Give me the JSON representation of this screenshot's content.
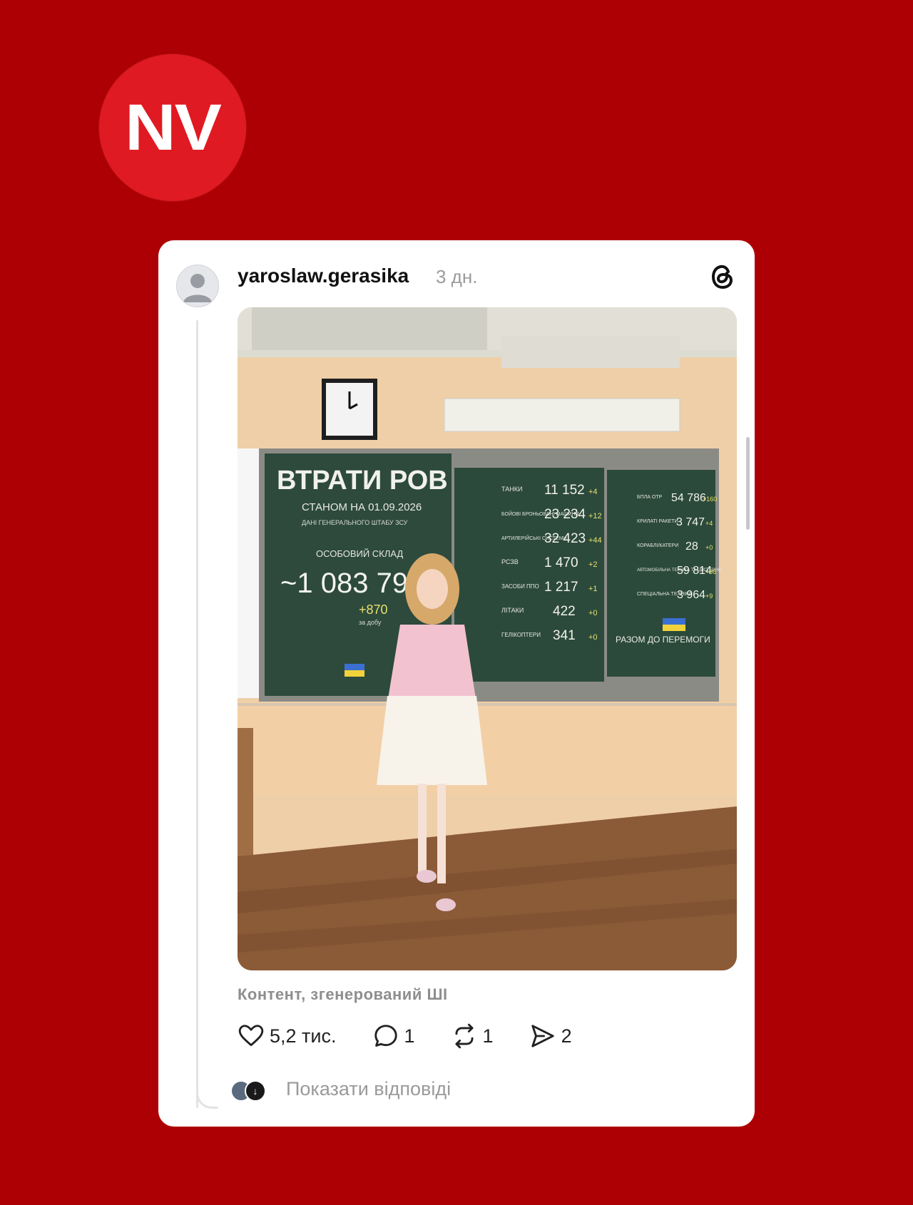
{
  "brand": {
    "logo_text": "NV"
  },
  "post": {
    "username": "yaroslaw.gerasika",
    "time": "3 дн.",
    "ai_label": "Контент, згенерований ШІ",
    "likes": "5,2 тис.",
    "comments": "1",
    "reposts": "1",
    "shares": "2",
    "show_replies": "Показати відповіді"
  },
  "board": {
    "title": "ВТРАТИ РОВ",
    "date_line": "СТАНОМ НА 01.09.2026",
    "source_line": "ДАНІ ГЕНЕРАЛЬНОГО ШТАБУ ЗСУ",
    "personnel_label": "ОСОБОВИЙ СКЛАД",
    "personnel_total": "~1 083 790",
    "personnel_delta": "+870",
    "personnel_delta_note": "за добу",
    "slogan": "РАЗОМ ДО ПЕРЕМОГИ",
    "middle": [
      {
        "label": "ТАНКИ",
        "value": "11 152",
        "delta": "+4"
      },
      {
        "label": "БОЙОВІ БРОНЬОВАНІ МАШИНИ",
        "value": "23 234",
        "delta": "+12"
      },
      {
        "label": "АРТИЛЕРІЙСЬКІ СИСТЕМИ",
        "value": "32 423",
        "delta": "+44"
      },
      {
        "label": "РСЗВ",
        "value": "1 470",
        "delta": "+2"
      },
      {
        "label": "ЗАСОБИ ППО",
        "value": "1 217",
        "delta": "+1"
      },
      {
        "label": "ЛІТАКИ",
        "value": "422",
        "delta": "+0"
      },
      {
        "label": "ГЕЛІКОПТЕРИ",
        "value": "341",
        "delta": "+0"
      }
    ],
    "right": [
      {
        "label": "БПЛА ОТР",
        "value": "54 786",
        "delta": "+160"
      },
      {
        "label": "КРИЛАТІ РАКЕТИ",
        "value": "3 747",
        "delta": "+4"
      },
      {
        "label": "КОРАБЛІ/КАТЕРИ",
        "value": "28",
        "delta": "+0"
      },
      {
        "label": "АВТОМОБІЛЬНА ТЕХНІКА ТА ЦИСТЕРНИ",
        "value": "59 814",
        "delta": "+98"
      },
      {
        "label": "СПЕЦІАЛЬНА ТЕХНІКА",
        "value": "3 964",
        "delta": "+9"
      }
    ]
  },
  "colors": {
    "background": "#ad0005",
    "logo": "#e01a22",
    "board": "#2d4a3d"
  }
}
